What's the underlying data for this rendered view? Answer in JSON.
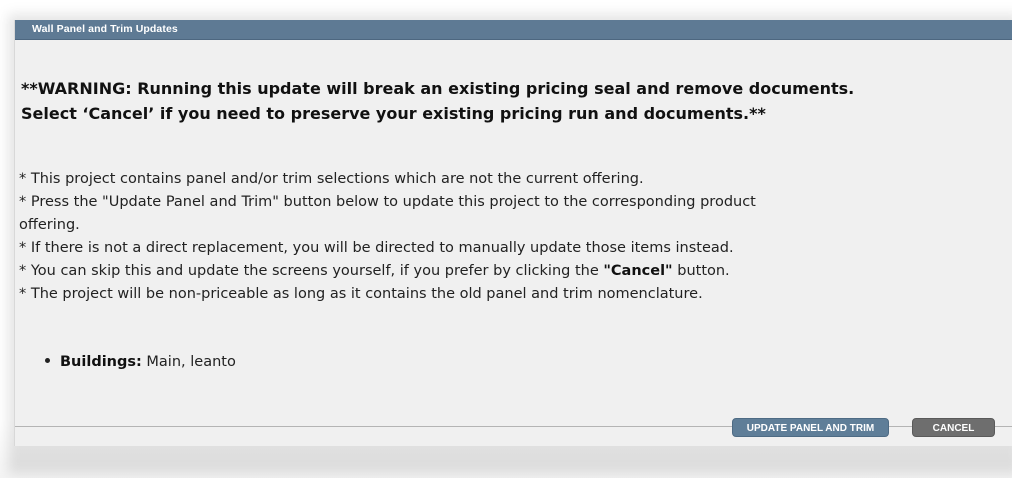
{
  "dialog": {
    "title": "Wall Panel and Trim Updates",
    "warning_lines": [
      "**WARNING: Running this update will break an existing pricing seal and remove documents.",
      "Select ‘Cancel’ if you need to preserve your existing pricing run and documents.**"
    ],
    "notes": [
      "* This project contains panel and/or trim selections which are not the current offering.",
      "* Press the \"Update Panel and Trim\" button below to update this project to the corresponding product",
      "offering.",
      "* If there is not a direct replacement, you will be directed to manually update those items instead.",
      "* You can skip this and update the screens yourself, if you prefer by clicking the ",
      "* The project will be non-priceable as long as it contains the old panel and trim nomenclature."
    ],
    "skip_note_bold": "\"Cancel\"",
    "skip_note_tail": " button.",
    "buildings": {
      "label": "Buildings:",
      "value": " Main, leanto"
    },
    "buttons": {
      "update": "UPDATE PANEL AND TRIM",
      "cancel": "CANCEL"
    }
  },
  "colors": {
    "title_bar": "#5e7a94",
    "dialog_bg": "#f0f0f0",
    "update_button": "#5f7e98",
    "cancel_button": "#6e6e6e"
  }
}
